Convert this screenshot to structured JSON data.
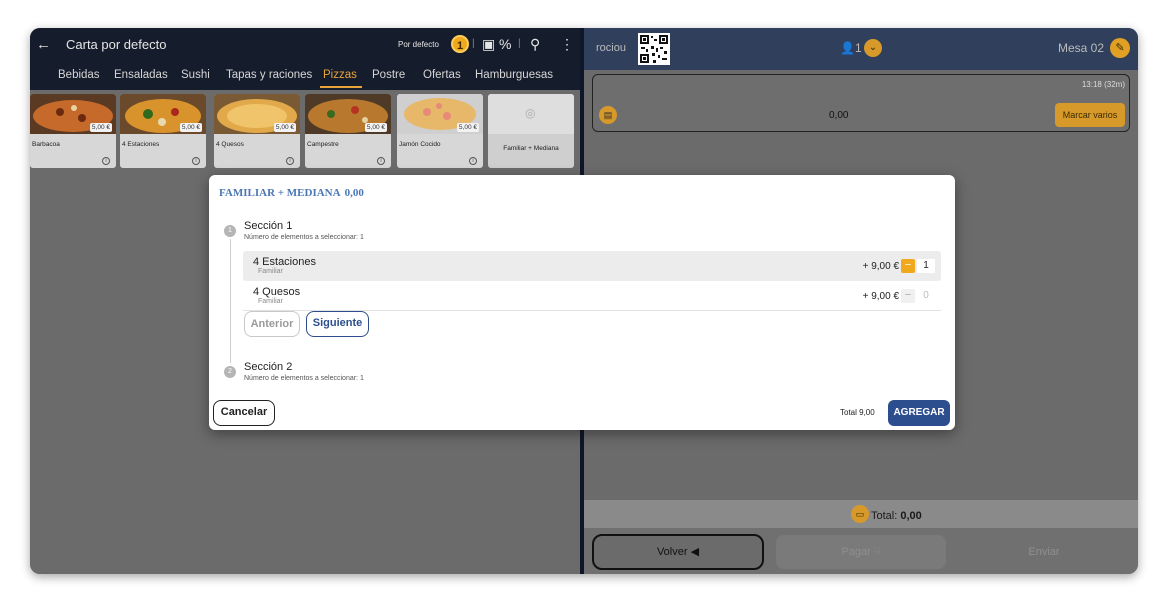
{
  "menu": {
    "back_icon": "arrow-left-icon",
    "title": "Carta por defecto",
    "default_label": "Por defecto",
    "coin_value": "1",
    "percent": "%",
    "tabs": [
      "Bebidas",
      "Ensaladas",
      "Sushi",
      "Tapas y raciones",
      "Pizzas",
      "Postre",
      "Ofertas",
      "Hamburguesas"
    ],
    "active_tab": "Pizzas"
  },
  "products": [
    {
      "name": "Barbacoa",
      "price": "5,00 €"
    },
    {
      "name": "4 Estaciones",
      "price": "5,00 €"
    },
    {
      "name": "4 Quesos",
      "price": "5,00 €"
    },
    {
      "name": "Campestre",
      "price": "5,00 €"
    },
    {
      "name": "Jamón Cocido",
      "price": "5,00 €"
    },
    {
      "name": "Familiar + Mediana",
      "price": ""
    }
  ],
  "table": {
    "user": "rociou",
    "diners": "1",
    "name": "Mesa 02",
    "order_time": "13:18 (32m)",
    "order_amount": "0,00",
    "mark_several": "Marcar varios",
    "total_label": "Total:",
    "total_value": "0,00",
    "back_button": "Volver",
    "pay_button": "Pagar",
    "send_button": "Enviar"
  },
  "modal": {
    "title": "FAMILIAR + MEDIANA",
    "title_value": "0,00",
    "sections": [
      {
        "step": "1",
        "title": "Sección 1",
        "subtitle": "Número de elementos a seleccionar: 1"
      },
      {
        "step": "2",
        "title": "Sección 2",
        "subtitle": "Número de elementos a seleccionar: 1"
      }
    ],
    "items": [
      {
        "name": "4 Estaciones",
        "sub": "Familiar",
        "price": "+ 9,00 €",
        "qty": "1"
      },
      {
        "name": "4 Quesos",
        "sub": "Familiar",
        "price": "+ 9,00 €",
        "qty": "0"
      }
    ],
    "prev_button": "Anterior",
    "next_button": "Siguiente",
    "cancel_button": "Cancelar",
    "total": "Total 9,00",
    "add_button": "AGREGAR"
  },
  "colors": {
    "accent_orange": "#f0a81c",
    "primary_blue": "#2d4e8e",
    "dark_header": "#151c2b"
  }
}
